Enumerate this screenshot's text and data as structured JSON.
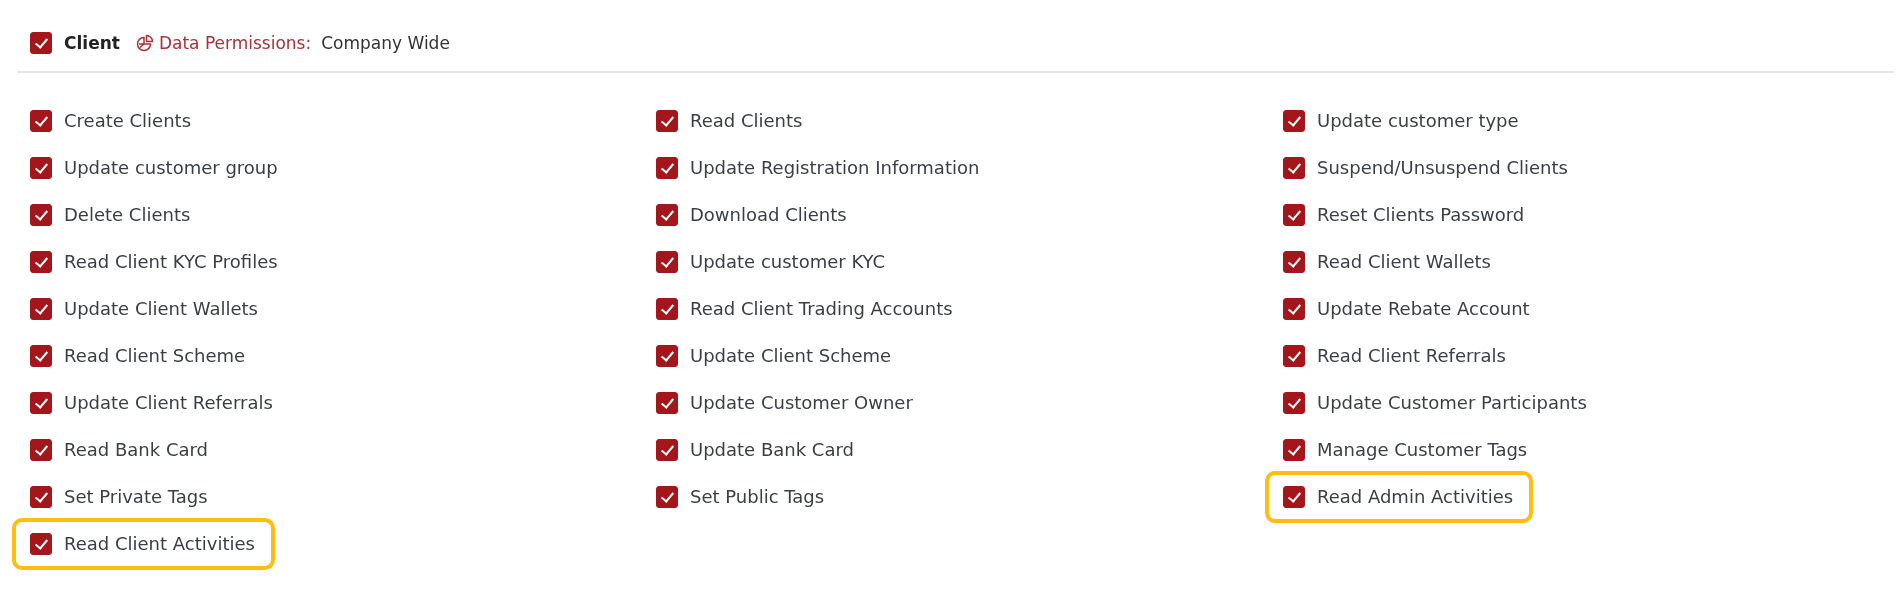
{
  "section": {
    "checked": true,
    "title": "Client",
    "permissions_label": "Data Permissions:",
    "permissions_value": "Company Wide"
  },
  "items": [
    {
      "label": "Create Clients",
      "checked": true,
      "highlighted": false
    },
    {
      "label": "Read Clients",
      "checked": true,
      "highlighted": false
    },
    {
      "label": "Update customer type",
      "checked": true,
      "highlighted": false
    },
    {
      "label": "Update customer group",
      "checked": true,
      "highlighted": false
    },
    {
      "label": "Update Registration Information",
      "checked": true,
      "highlighted": false
    },
    {
      "label": "Suspend/Unsuspend Clients",
      "checked": true,
      "highlighted": false
    },
    {
      "label": "Delete Clients",
      "checked": true,
      "highlighted": false
    },
    {
      "label": "Download Clients",
      "checked": true,
      "highlighted": false
    },
    {
      "label": "Reset Clients Password",
      "checked": true,
      "highlighted": false
    },
    {
      "label": "Read Client KYC Profiles",
      "checked": true,
      "highlighted": false
    },
    {
      "label": "Update customer KYC",
      "checked": true,
      "highlighted": false
    },
    {
      "label": "Read Client Wallets",
      "checked": true,
      "highlighted": false
    },
    {
      "label": "Update Client Wallets",
      "checked": true,
      "highlighted": false
    },
    {
      "label": "Read Client Trading Accounts",
      "checked": true,
      "highlighted": false
    },
    {
      "label": "Update Rebate Account",
      "checked": true,
      "highlighted": false
    },
    {
      "label": "Read Client Scheme",
      "checked": true,
      "highlighted": false
    },
    {
      "label": "Update Client Scheme",
      "checked": true,
      "highlighted": false
    },
    {
      "label": "Read Client Referrals",
      "checked": true,
      "highlighted": false
    },
    {
      "label": "Update Client Referrals",
      "checked": true,
      "highlighted": false
    },
    {
      "label": "Update Customer Owner",
      "checked": true,
      "highlighted": false
    },
    {
      "label": "Update Customer Participants",
      "checked": true,
      "highlighted": false
    },
    {
      "label": "Read Bank Card",
      "checked": true,
      "highlighted": false
    },
    {
      "label": "Update Bank Card",
      "checked": true,
      "highlighted": false
    },
    {
      "label": "Manage Customer Tags",
      "checked": true,
      "highlighted": false
    },
    {
      "label": "Set Private Tags",
      "checked": true,
      "highlighted": false
    },
    {
      "label": "Set Public Tags",
      "checked": true,
      "highlighted": false
    },
    {
      "label": "Read Admin Activities",
      "checked": true,
      "highlighted": true
    },
    {
      "label": "Read Client Activities",
      "checked": true,
      "highlighted": true
    }
  ]
}
